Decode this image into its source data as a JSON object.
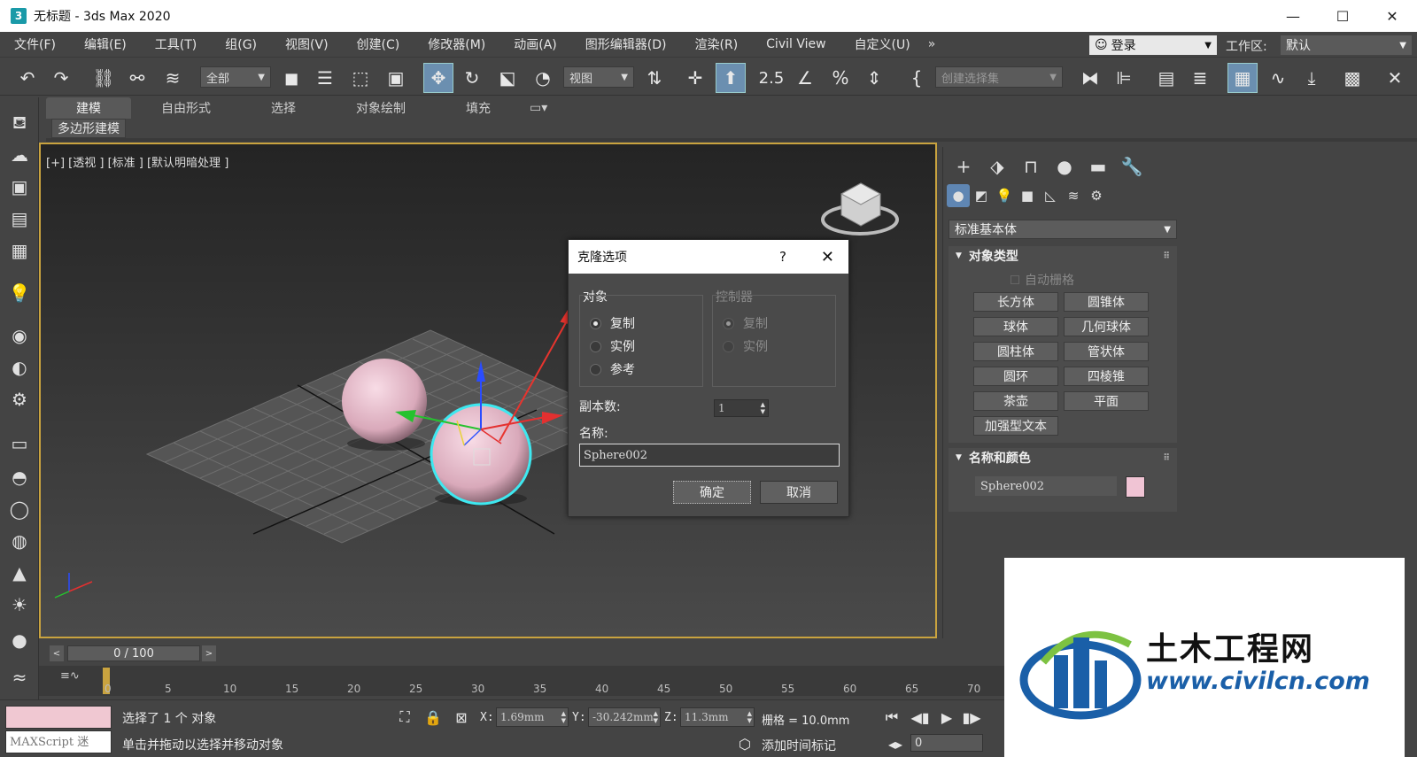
{
  "window": {
    "title": "无标题 - 3ds Max 2020",
    "app_icon": "3",
    "minimize": "—",
    "maximize": "☐",
    "close": "✕"
  },
  "menu": {
    "items": [
      "文件(F)",
      "编辑(E)",
      "工具(T)",
      "组(G)",
      "视图(V)",
      "创建(C)",
      "修改器(M)",
      "动画(A)",
      "图形编辑器(D)",
      "渲染(R)",
      "Civil View",
      "自定义(U)"
    ],
    "more": "»",
    "login": "登录",
    "workspace_label": "工作区:",
    "workspace_value": "默认"
  },
  "toolbar": {
    "selection_filter": "全部",
    "ref_coord": "视图",
    "named_selection_placeholder": "创建选择集",
    "snap_value": "2.5"
  },
  "ribbon": {
    "tabs": [
      "建模",
      "自由形式",
      "选择",
      "对象绘制",
      "填充"
    ],
    "sub_label": "多边形建模"
  },
  "viewport": {
    "label": "[+] [透视 ] [标准 ] [默认明暗处理 ]"
  },
  "dialog": {
    "title": "克隆选项",
    "help": "?",
    "close": "✕",
    "object_group": "对象",
    "object_options": [
      "复制",
      "实例",
      "参考"
    ],
    "object_selected": "复制",
    "controller_group": "控制器",
    "controller_options": [
      "复制",
      "实例"
    ],
    "copies_label": "副本数:",
    "copies_value": "1",
    "name_label": "名称:",
    "name_value": "Sphere002",
    "ok": "确定",
    "cancel": "取消"
  },
  "command_panel": {
    "category_dropdown": "标准基本体",
    "object_type_title": "对象类型",
    "autogrid": "自动栅格",
    "object_buttons": [
      "长方体",
      "圆锥体",
      "球体",
      "几何球体",
      "圆柱体",
      "管状体",
      "圆环",
      "四棱锥",
      "茶壶",
      "平面",
      "加强型文本"
    ],
    "name_color_title": "名称和颜色",
    "object_name": "Sphere002",
    "object_color": "#f0c4d4"
  },
  "timeline": {
    "frame_display": "0 / 100",
    "ticks": [
      "0",
      "5",
      "10",
      "15",
      "20",
      "25",
      "30",
      "35",
      "40",
      "45",
      "50",
      "55",
      "60",
      "65",
      "70"
    ]
  },
  "status": {
    "maxscript_placeholder": "MAXScript 迷",
    "selection_info": "选择了 1 个 对象",
    "prompt": "单击并拖动以选择并移动对象",
    "x_label": "X:",
    "x_value": "1.69mm",
    "y_label": "Y:",
    "y_value": "-30.242mm",
    "z_label": "Z:",
    "z_value": "11.3mm",
    "grid": "栅格 = 10.0mm",
    "add_time_tag": "添加时间标记",
    "current_frame": "0"
  },
  "watermark": {
    "brand": "土木工程网",
    "url": "www.civilcn.com"
  },
  "colors": {
    "accent_blue": "#6b8fb0",
    "sphere_pink": "#f0c4d4",
    "viewport_border": "#c9a33f",
    "selection_cyan": "#3ee8f0",
    "annotation_red": "#e8342e"
  }
}
